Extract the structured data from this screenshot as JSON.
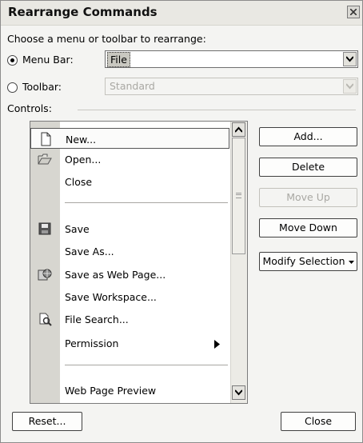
{
  "dialog": {
    "title": "Rearrange Commands",
    "prompt": "Choose a menu or toolbar to rearrange:",
    "menu_bar": {
      "label": "Menu Bar:",
      "value": "File",
      "selected": true
    },
    "toolbar": {
      "label": "Toolbar:",
      "value": "Standard",
      "selected": false
    },
    "controls_label": "Controls:",
    "list_items": [
      {
        "label": "New...",
        "icon": "new-document-icon",
        "selected": true
      },
      {
        "label": "Open...",
        "icon": "open-folder-icon"
      },
      {
        "label": "Close"
      },
      {
        "label": "Save",
        "icon": "save-disk-icon"
      },
      {
        "label": "Save As..."
      },
      {
        "label": "Save as Web Page...",
        "icon": "web-page-icon"
      },
      {
        "label": "Save Workspace..."
      },
      {
        "label": "File Search...",
        "icon": "file-search-icon"
      },
      {
        "label": "Permission",
        "submenu": true
      },
      {
        "label": "Web Page Preview"
      }
    ],
    "buttons": {
      "add": "Add...",
      "delete": "Delete",
      "move_up": "Move Up",
      "move_down": "Move Down",
      "modify_selection": "Modify Selection",
      "reset": "Reset...",
      "close": "Close"
    }
  }
}
